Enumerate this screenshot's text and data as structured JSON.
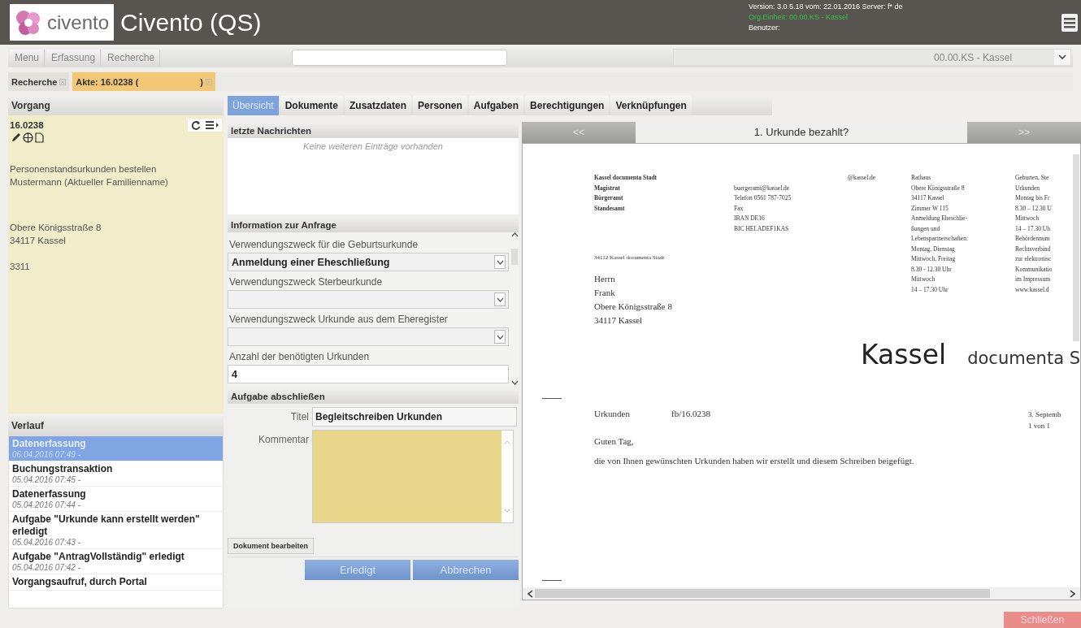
{
  "header": {
    "logo_text": "civento",
    "title": "Civento (QS)",
    "version": "Version: 3.0.5.18 vom: 22.01.2016 Server: f* de",
    "org_unit": "Org.Einheit: 00.00.KS - Kassel",
    "user": "Benutzer:"
  },
  "menu_bar": {
    "items": [
      "Menu",
      "Erfassung",
      "Recherche"
    ],
    "org_select": "00.00.KS - Kassel"
  },
  "open_tabs": [
    {
      "label": "Recherche",
      "selected": false
    },
    {
      "label": "Akte: 16.0238 (",
      "suffix": ")",
      "selected": true
    }
  ],
  "vorgang": {
    "title": "Vorgang",
    "number": "16.0238",
    "blocks": [
      [
        "Personenstandsurkunden bestellen",
        "Mustermann (Aktueller Familienname)"
      ],
      [
        "Obere Königsstraße 8",
        "34117 Kassel"
      ],
      [
        "3311"
      ]
    ]
  },
  "verlauf": {
    "title": "Verlauf",
    "items": [
      {
        "title": "Datenerfassung",
        "date": "06.04.2016 07:49 -",
        "selected": true
      },
      {
        "title": "Buchungstransaktion",
        "date": "05.04.2016 07:45 -",
        "selected": false
      },
      {
        "title": "Datenerfassung",
        "date": "05.04.2016 07:44 -",
        "selected": false
      },
      {
        "title": "Aufgabe \"Urkunde kann erstellt werden\" erledigt",
        "date": "05.04.2016 07:43 -",
        "selected": false
      },
      {
        "title": "Aufgabe \"AntragVollständig\" erledigt",
        "date": "05.04.2016 07:42 -",
        "selected": false
      },
      {
        "title": "Vorgangsaufruf, durch Portal",
        "selected": false
      }
    ]
  },
  "tabs": [
    {
      "label": "Übersicht",
      "selected": true
    },
    {
      "label": "Dokumente",
      "selected": false
    },
    {
      "label": "Zusatzdaten",
      "selected": false
    },
    {
      "label": "Personen",
      "selected": false
    },
    {
      "label": "Aufgaben",
      "selected": false
    },
    {
      "label": "Berechtigungen",
      "selected": false
    },
    {
      "label": "Verknüpfungen",
      "selected": false
    }
  ],
  "messages": {
    "title": "letzte Nachrichten",
    "empty": "Keine weiteren Einträge vorhanden"
  },
  "info": {
    "title": "Information zur Anfrage",
    "fields": [
      {
        "label": "Verwendungszweck für die Geburtsurkunde",
        "value": "Anmeldung einer Eheschließung",
        "kind": "select"
      },
      {
        "label": "Verwendungszweck Sterbeurkunde",
        "kind": "select"
      },
      {
        "label": "Verwendungszweck Urkunde aus dem Eheregister",
        "kind": "select"
      },
      {
        "label": "Anzahl der benötigten Urkunden",
        "value": "4",
        "kind": "text"
      }
    ]
  },
  "task": {
    "title": "Aufgabe abschließen",
    "title_label": "Titel",
    "title_value": "Begleitschreiben Urkunden",
    "comment_label": "Kommentar",
    "edit_tab": "Dokument bearbeiten",
    "buttons": [
      "Erledigt",
      "Abbrechen"
    ]
  },
  "document": {
    "prev": "<<",
    "next": ">>",
    "heading": "1. Urkunde bezahlt?",
    "col_1": [
      "Kassel documenta Stadt",
      "Magistrat",
      "Bürgeramt",
      "Standesamt"
    ],
    "col_2": [
      "@kassel.de",
      "buergeramt@kassel.de",
      "Telefon 0561 787-7025",
      "Fax",
      "IBAN DE16",
      "BIC HELADEF1KAS"
    ],
    "col_3": [
      "Rathaus",
      "Obere Königsstraße 8",
      "34117 Kassel",
      "Zimmer W 115",
      "Anmeldung Eheschlie-",
      "ßungen und",
      "Lebenspartnerschaften:",
      "Montag, Dienstag",
      "Mittwoch, Freitag",
      "8.30 - 12.30 Uhr",
      "Mittwoch",
      "14 – 17.30 Uhr"
    ],
    "col_4": [
      "Geburten, Ste",
      "Urkunden",
      "Montag bis Fr",
      "8.30 – 12.30 U",
      "Mittwoch",
      "14 – 17.30 Uh",
      "Behördennum",
      "Rechtsverbind",
      "zur elektronisc",
      "Kommunikatio",
      "im Impressum",
      "www.kassel.d"
    ],
    "sender": "34112 Kassel documenta Stadt",
    "address": [
      "Herrn",
      "Frank",
      "Obere Königsstraße 8",
      "34117 Kassel"
    ],
    "logo_1": "Kassel",
    "logo_2": "documenta S",
    "subject": "Urkunden",
    "reference": "fb/16.0238",
    "date": "3. Septemb",
    "page": "1 von 1",
    "greeting": "Guten Tag,",
    "body": "die von Ihnen gewünschten Urkunden haben wir erstellt und diesem Schreiben beigefügt."
  },
  "footer": {
    "close_button": "Schließen"
  }
}
